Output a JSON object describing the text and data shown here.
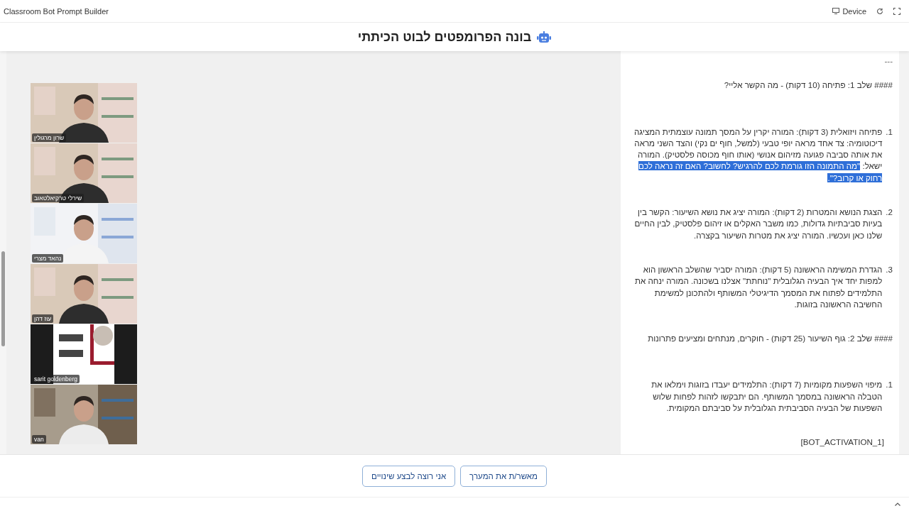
{
  "app_bar": {
    "title": "Classroom Bot Prompt Builder",
    "device_label": "Device"
  },
  "header": {
    "title": "בונה הפרומפטים לבוט הכיתתי"
  },
  "participants": [
    {
      "name": "שרון מרגולין"
    },
    {
      "name": "שירלי טרקיאלטאוב"
    },
    {
      "name": "נהאד מצרי"
    },
    {
      "name": "עוז דהן"
    },
    {
      "name": "sarit goldenberg"
    },
    {
      "name": "van"
    }
  ],
  "document": [
    {
      "kind": "separator",
      "text": "---"
    },
    {
      "kind": "heading",
      "text": "#### שלב 1: פתיחה (10 דקות) - מה הקשר אליי?"
    },
    {
      "kind": "list_item",
      "number": "1.",
      "text": "פתיחה ויזואלית (3 דקות): המורה יקרין על המסך תמונה עוצמתית המציגה דיכוטומיה: צד אחד מראה יופי טבעי (למשל, חוף ים נקי) והצד השני מראה את אותה סביבה פגועה מזיהום אנושי (אותו חוף מכוסה פלסטיק). המורה ישאל: ",
      "selection": "\"מה התמונה הזו גורמת לכם להרגיש? לחשוב? האם זה נראה לכם רחוק או קרוב?\"."
    },
    {
      "kind": "list_item",
      "number": "2.",
      "text": "הצגת הנושא והמטרות (2 דקות): המורה יציג את נושא השיעור: הקשר בין בעיות סביבתיות גדולות, כמו משבר האקלים או זיהום פלסטיק, לבין החיים שלנו כאן ועכשיו. המורה יציג את מטרות השיעור בקצרה."
    },
    {
      "kind": "list_item",
      "number": "3.",
      "text": "הגדרת המשימה הראשונה (5 דקות): המורה יסביר שהשלב הראשון הוא למפות יחד איך הבעיה הגלובלית \"נוחתת\" אצלנו בשכונה. המורה ינחה את התלמידים לפתוח את המסמך הדיגיטלי המשותף ולהתכונן למשימת החשיבה הראשונה בזוגות."
    },
    {
      "kind": "heading",
      "text": "#### שלב 2: גוף השיעור (25 דקות) - חוקרים, מנתחים ומציעים פתרונות"
    },
    {
      "kind": "list_item",
      "number": "1.",
      "text": "מיפוי השפעות מקומיות (7 דקות): התלמידים יעבדו בזוגות וימלאו את הטבלה הראשונה במסמך המשותף. הם יתבקשו לזהות לפחות שלוש השפעות של הבעיה הסביבתית הגלובלית על סביבתם המקומית."
    },
    {
      "kind": "token",
      "text": "[BOT_ACTIVATION_1]"
    }
  ],
  "actions": [
    {
      "label": "מאשר/ת את המערך"
    },
    {
      "label": "אני רוצה לבצע שינויים"
    }
  ]
}
